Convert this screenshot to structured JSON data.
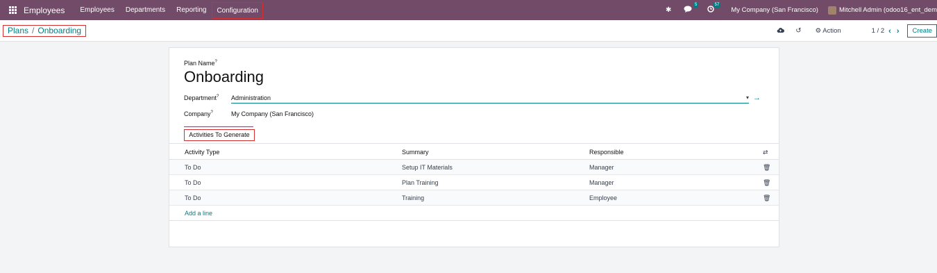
{
  "navbar": {
    "app_name": "Employees",
    "menu": [
      {
        "label": "Employees"
      },
      {
        "label": "Departments"
      },
      {
        "label": "Reporting"
      },
      {
        "label": "Configuration"
      }
    ],
    "messages_badge": "5",
    "activities_badge": "57",
    "company": "My Company (San Francisco)",
    "user": "Mitchell Admin (odoo16_ent_dem"
  },
  "breadcrumb": {
    "parent": "Plans",
    "separator": "/",
    "current": "Onboarding"
  },
  "control_panel": {
    "action_label": "Action",
    "pager": "1 / 2",
    "create_label": "Create"
  },
  "form": {
    "plan_name_label": "Plan Name",
    "help_mark": "?",
    "plan_name": "Onboarding",
    "department_label": "Department",
    "department_value": "Administration",
    "company_label": "Company",
    "company_value": "My Company (San Francisco)",
    "tab_label": "Activities To Generate"
  },
  "table": {
    "headers": {
      "activity_type": "Activity Type",
      "summary": "Summary",
      "responsible": "Responsible"
    },
    "rows": [
      {
        "activity_type": "To Do",
        "summary": "Setup IT Materials",
        "responsible": "Manager"
      },
      {
        "activity_type": "To Do",
        "summary": "Plan Training",
        "responsible": "Manager"
      },
      {
        "activity_type": "To Do",
        "summary": "Training",
        "responsible": "Employee"
      }
    ],
    "add_line": "Add a line"
  },
  "colors": {
    "navbar": "#714b67",
    "accent": "#017e84",
    "highlight_box": "#d32f2f"
  }
}
